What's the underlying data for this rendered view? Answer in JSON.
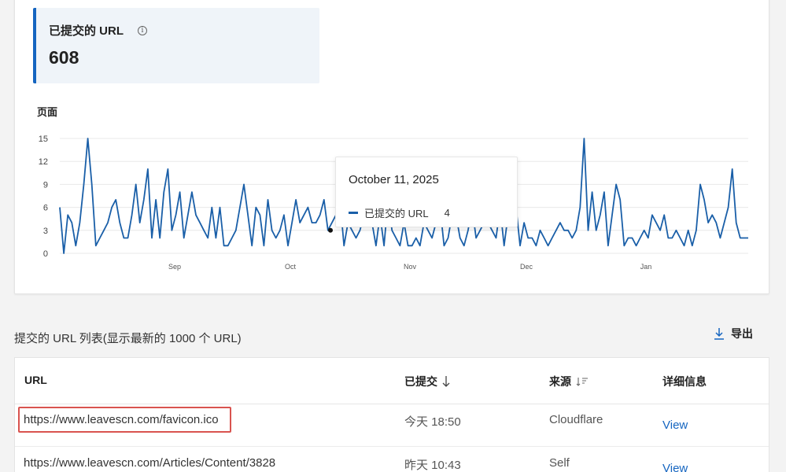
{
  "stat": {
    "title": "已提交的 URL",
    "info_icon": "info-icon",
    "value": "608"
  },
  "chart": {
    "label": "页面"
  },
  "chart_data": {
    "type": "line",
    "series": [
      {
        "name": "已提交的 URL",
        "color": "#1a5fa8",
        "values": [
          6,
          0,
          5,
          4,
          1,
          4,
          9,
          15,
          9,
          1,
          2,
          3,
          4,
          6,
          7,
          4,
          2,
          2,
          5,
          9,
          4,
          7,
          11,
          2,
          7,
          2,
          8,
          11,
          3,
          5,
          8,
          2,
          5,
          8,
          5,
          4,
          3,
          2,
          6,
          2,
          6,
          1,
          1,
          2,
          3,
          6,
          9,
          5,
          1,
          6,
          5,
          1,
          7,
          3,
          2,
          3,
          5,
          1,
          4,
          7,
          4,
          5,
          6,
          4,
          4,
          5,
          7,
          3,
          4,
          5,
          7,
          1,
          4,
          3,
          2,
          3,
          5,
          6,
          4,
          1,
          5,
          1,
          7,
          3,
          2,
          1,
          4,
          1,
          1,
          2,
          1,
          4,
          3,
          2,
          4,
          6,
          1,
          2,
          5,
          5,
          2,
          1,
          3,
          6,
          2,
          3,
          4,
          4,
          3,
          2,
          6,
          1,
          5,
          4,
          6,
          1,
          4,
          2,
          2,
          1,
          3,
          2,
          1,
          2,
          3,
          4,
          3,
          3,
          2,
          3,
          6,
          15,
          3,
          8,
          3,
          5,
          8,
          1,
          5,
          9,
          7,
          1,
          2,
          2,
          1,
          2,
          3,
          2,
          5,
          4,
          3,
          5,
          2,
          2,
          3,
          2,
          1,
          3,
          1,
          3,
          9,
          7,
          4,
          5,
          4,
          2,
          4,
          6,
          11,
          4,
          2,
          2,
          2
        ]
      }
    ],
    "x_ticks": [
      "Sep",
      "Oct",
      "Nov",
      "Dec",
      "Jan"
    ],
    "y_ticks": [
      0,
      3,
      6,
      9,
      12,
      15
    ],
    "ylim": [
      0,
      15
    ],
    "grid": true,
    "tooltip": {
      "date": "October 11, 2025",
      "series": "已提交的 URL",
      "value": "4"
    }
  },
  "list": {
    "title": "提交的 URL 列表(显示最新的 1000 个 URL)",
    "export_label": "导出"
  },
  "table": {
    "columns": {
      "url": "URL",
      "submitted": "已提交",
      "source": "来源",
      "details": "详细信息"
    },
    "rows": [
      {
        "url": "https://www.leavescn.com/favicon.ico",
        "submitted": "今天 18:50",
        "source": "Cloudflare",
        "details": "View"
      },
      {
        "url": "https://www.leavescn.com/Articles/Content/3828",
        "submitted": "昨天 10:43",
        "source": "Self",
        "details": "View"
      }
    ]
  }
}
